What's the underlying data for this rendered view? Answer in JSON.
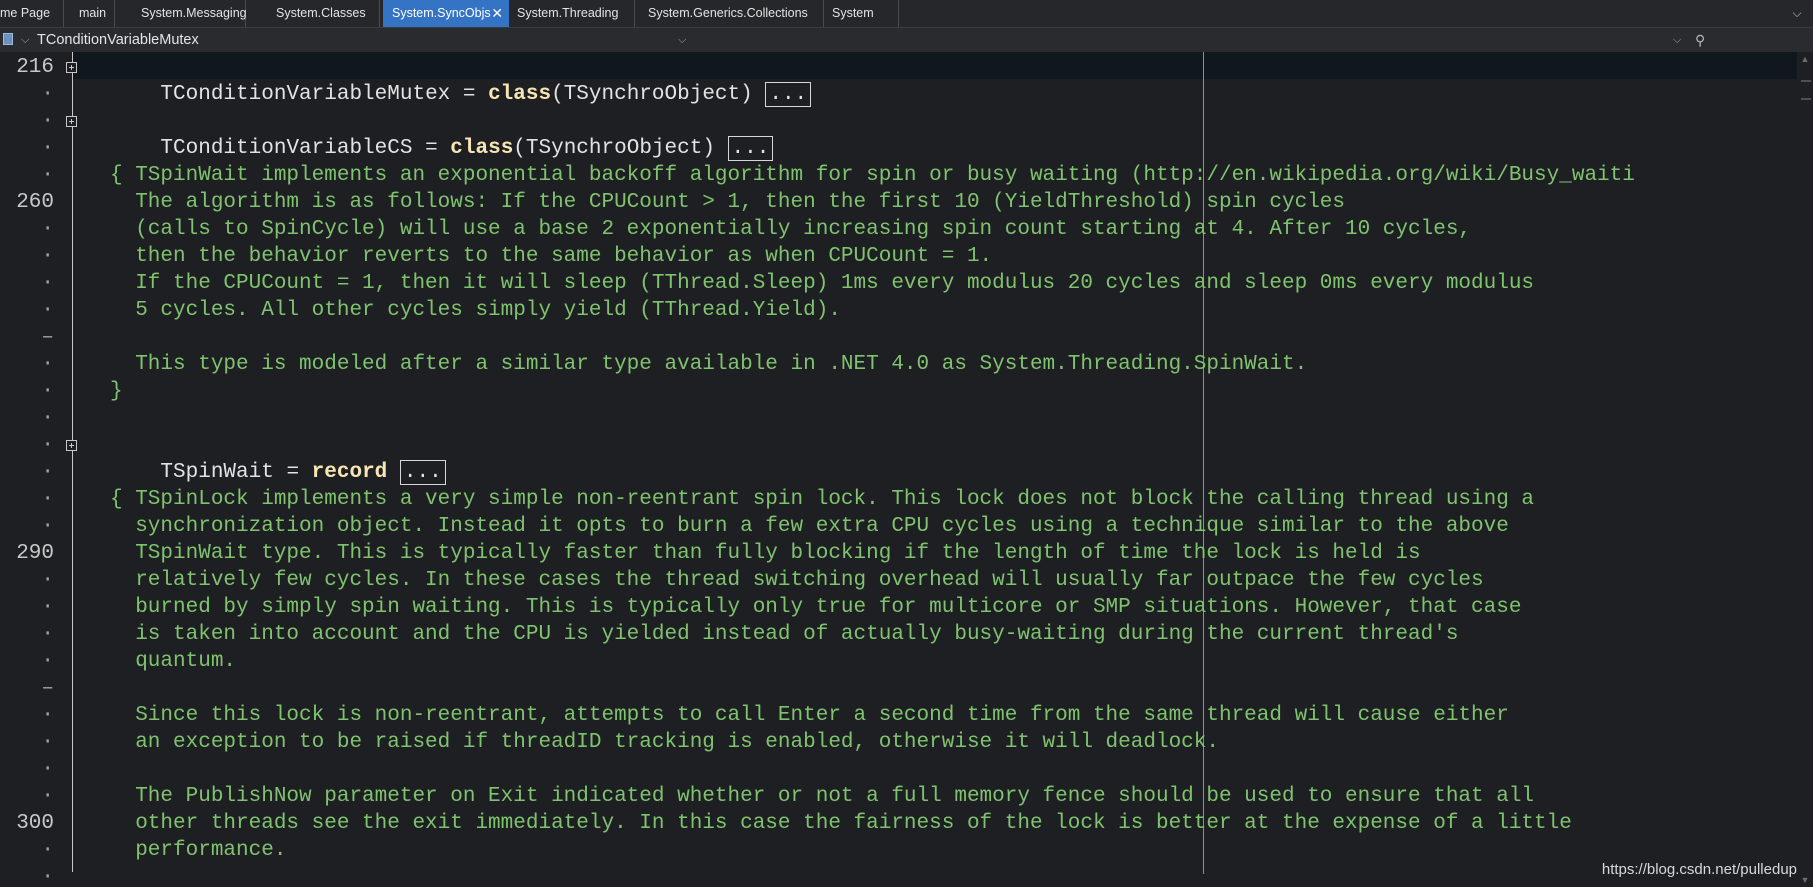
{
  "tabs": [
    {
      "label": "me Page"
    },
    {
      "label": "main"
    },
    {
      "label": "System.Messaging"
    },
    {
      "label": "System.Classes"
    },
    {
      "label": "System.SyncObjs",
      "active": true,
      "close_glyph": "✕"
    },
    {
      "label": "System.Threading"
    },
    {
      "label": "System.Generics.Collections"
    },
    {
      "label": "System"
    }
  ],
  "tabbar_right_icon": "chevron-down-icon",
  "navigator": {
    "type_icon": "class-icon",
    "current_symbol": "TConditionVariableMutex",
    "expander_glyph": "⌵",
    "dropdown_glyph": "⌵",
    "search_glyph": "⚲"
  },
  "gutter": {
    "line_numbers": [
      "216",
      "·",
      "·",
      "·",
      "·",
      "260",
      "·",
      "·",
      "·",
      "·",
      "–",
      "·",
      "·",
      "·",
      "·",
      "·",
      "·",
      "·",
      "290",
      "·",
      "·",
      "·",
      "·",
      "–",
      "·",
      "·",
      "·",
      "·",
      "300",
      "·",
      "·"
    ]
  },
  "code": {
    "line1_name": "TConditionVariableMutex = ",
    "line1_kw": "class",
    "line1_rest": "(TSynchroObject) ",
    "ellipsis": "...",
    "line2_name": "TConditionVariableCS = ",
    "line2_kw": "class",
    "line2_rest": "(TSynchroObject) ",
    "spinwait_name": "TSpinWait = ",
    "spinwait_kw": "record",
    "comment1": [
      "{ TSpinWait implements an exponential backoff algorithm for spin or busy waiting (http://en.wikipedia.org/wiki/Busy_waiti",
      "  The algorithm is as follows: If the CPUCount > 1, then the first 10 (YieldThreshold) spin cycles",
      "  (calls to SpinCycle) will use a base 2 exponentially increasing spin count starting at 4. After 10 cycles,",
      "  then the behavior reverts to the same behavior as when CPUCount = 1.",
      "  If the CPUCount = 1, then it will sleep (TThread.Sleep) 1ms every modulus 20 cycles and sleep 0ms every modulus",
      "  5 cycles. All other cycles simply yield (TThread.Yield).",
      "",
      "  This type is modeled after a similar type available in .NET 4.0 as System.Threading.SpinWait.",
      "}"
    ],
    "comment2": [
      "{ TSpinLock implements a very simple non-reentrant spin lock. This lock does not block the calling thread using a",
      "  synchronization object. Instead it opts to burn a few extra CPU cycles using a technique similar to the above",
      "  TSpinWait type. This is typically faster than fully blocking if the length of time the lock is held is",
      "  relatively few cycles. In these cases the thread switching overhead will usually far outpace the few cycles",
      "  burned by simply spin waiting. This is typically only true for multicore or SMP situations. However, that case",
      "  is taken into account and the CPU is yielded instead of actually busy-waiting during the current thread's",
      "  quantum.",
      "",
      "  Since this lock is non-reentrant, attempts to call Enter a second time from the same thread will cause either",
      "  an exception to be raised if threadID tracking is enabled, otherwise it will deadlock.",
      "",
      "  The PublishNow parameter on Exit indicated whether or not a full memory fence should be used to ensure that all",
      "  other threads see the exit immediately. In this case the fairness of the lock is better at the expense of a little",
      "  performance."
    ]
  },
  "watermark": "https://blog.csdn.net/pulledup",
  "colors": {
    "background": "#1e1f22",
    "active_tab": "#3574c4",
    "comment": "#7fc36f",
    "keyword": "#f7e6b3",
    "identifier": "#e3e3e3"
  }
}
